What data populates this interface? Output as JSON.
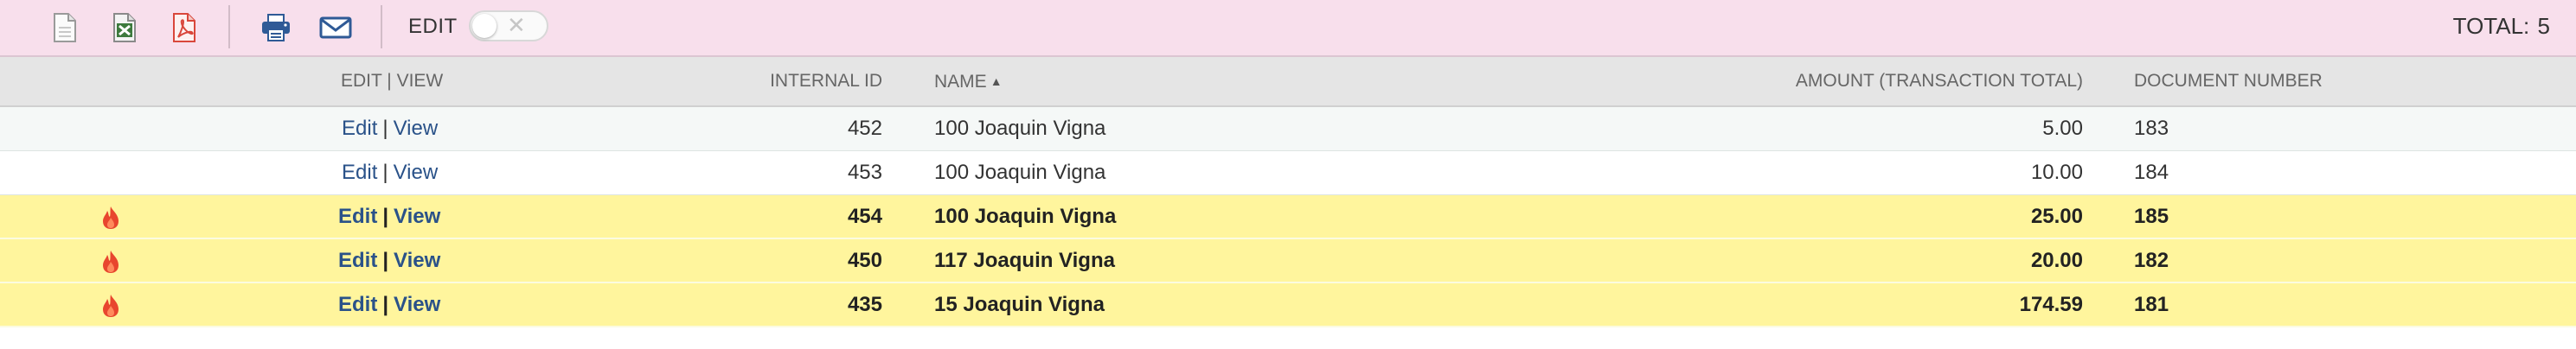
{
  "toolbar": {
    "buttons": [
      {
        "name": "export-blank-document",
        "icon": "document-icon"
      },
      {
        "name": "export-excel",
        "icon": "excel-icon"
      },
      {
        "name": "export-pdf",
        "icon": "pdf-icon"
      },
      {
        "name": "print",
        "icon": "printer-icon"
      },
      {
        "name": "email",
        "icon": "envelope-icon"
      }
    ],
    "edit_label": "EDIT",
    "edit_toggle_on": false,
    "total_label": "TOTAL:",
    "total_value": "5"
  },
  "table": {
    "columns": {
      "edit_view": "EDIT | VIEW",
      "internal_id": "INTERNAL ID",
      "name": "NAME",
      "amount": "AMOUNT (TRANSACTION TOTAL)",
      "document_number": "DOCUMENT NUMBER"
    },
    "sort_column": "name",
    "sort_direction": "ascending",
    "rows": [
      {
        "edit": "Edit",
        "sep": "|",
        "view": "View",
        "internal_id": "452",
        "name": "100 Joaquin Vigna",
        "amount": "5.00",
        "doc": "183",
        "highlighted": false
      },
      {
        "edit": "Edit",
        "sep": "|",
        "view": "View",
        "internal_id": "453",
        "name": "100 Joaquin Vigna",
        "amount": "10.00",
        "doc": "184",
        "highlighted": false
      },
      {
        "edit": "Edit",
        "sep": "|",
        "view": "View",
        "internal_id": "454",
        "name": "100 Joaquin Vigna",
        "amount": "25.00",
        "doc": "185",
        "highlighted": true
      },
      {
        "edit": "Edit",
        "sep": "|",
        "view": "View",
        "internal_id": "450",
        "name": "117 Joaquin Vigna",
        "amount": "20.00",
        "doc": "182",
        "highlighted": true
      },
      {
        "edit": "Edit",
        "sep": "|",
        "view": "View",
        "internal_id": "435",
        "name": "15 Joaquin Vigna",
        "amount": "174.59",
        "doc": "181",
        "highlighted": true
      }
    ]
  },
  "colors": {
    "toolbar_bg": "#f8dfec",
    "header_bg": "#e5e5e5",
    "highlight_bg": "#fff59d",
    "link": "#2a5289",
    "flame": "#e8462e"
  }
}
